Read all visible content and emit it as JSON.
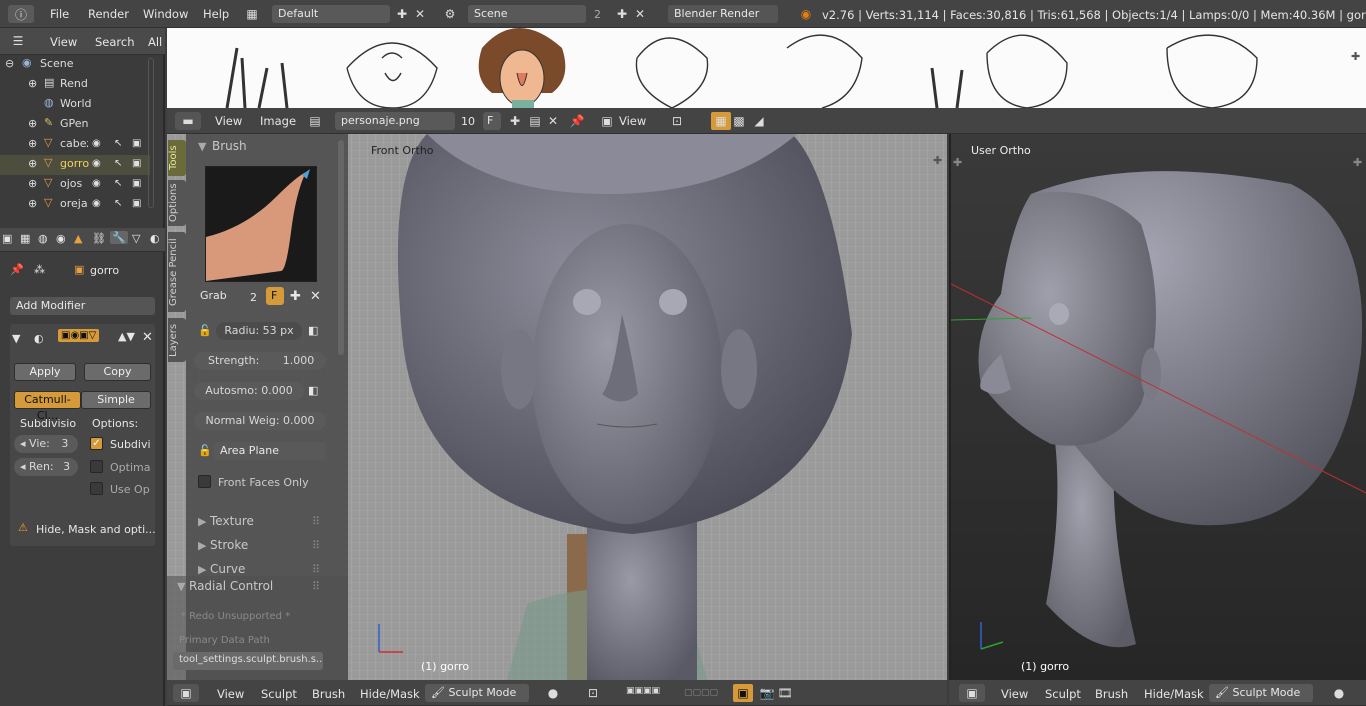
{
  "topbar": {
    "menus": [
      "File",
      "Render",
      "Window",
      "Help"
    ],
    "screen_layout": "Default",
    "scene": "Scene",
    "scene_users": "2",
    "engine": "Blender Render",
    "stats": "v2.76 | Verts:31,114 | Faces:30,816 | Tris:61,568 | Objects:1/4 | Lamps:0/0 | Mem:40.36M | gorro"
  },
  "outliner": {
    "view_label": "View",
    "search_label": "Search",
    "all_label": "All",
    "items": [
      {
        "label": "Scene",
        "icon": "scene-icon"
      },
      {
        "label": "Rend",
        "icon": "render-layers-icon"
      },
      {
        "label": "World",
        "icon": "world-icon"
      },
      {
        "label": "GPen",
        "icon": "grease-pencil-icon"
      },
      {
        "label": "cabeza",
        "icon": "mesh-icon"
      },
      {
        "label": "gorro",
        "icon": "mesh-icon"
      },
      {
        "label": "ojos",
        "icon": "mesh-icon"
      },
      {
        "label": "oreja",
        "icon": "mesh-icon"
      }
    ]
  },
  "properties": {
    "object_name": "gorro",
    "add_modifier": "Add Modifier",
    "apply": "Apply",
    "copy": "Copy",
    "catmull": "Catmull-Cl...",
    "simple": "Simple",
    "subdivisions_label": "Subdivisio",
    "options_label": "Options:",
    "view_field": "Vie:",
    "view_value": "3",
    "render_field": "Ren:",
    "render_value": "3",
    "subdiv_uv": "Subdivi",
    "optimal": "Optima",
    "use_op": "Use Op",
    "warning": "Hide, Mask and opti..."
  },
  "reference": {
    "menus": [
      "View",
      "Image"
    ],
    "image_name": "personaje.png",
    "image_users": "10",
    "fake_user": "F",
    "view_label": "View"
  },
  "tools": {
    "tabs": [
      "Tools",
      "Options",
      "Grease Pencil",
      "Layers"
    ],
    "brush_header": "Brush",
    "brush_name": "Grab",
    "brush_users": "2",
    "brush_fake": "F",
    "radius": "Radiu: 53 px",
    "strength_label": "Strength:",
    "strength_value": "1.000",
    "autosmooth": "Autosmo: 0.000",
    "normal_weight": "Normal Weig: 0.000",
    "plane": "Area Plane",
    "front_faces": "Front Faces Only",
    "sections": [
      "Texture",
      "Stroke",
      "Curve"
    ],
    "radial": "Radial Control",
    "redo": "* Redo Unsupported *",
    "primary": "Primary Data Path",
    "path_value": "tool_settings.sculpt.brush.s..."
  },
  "viewport_left": {
    "label": "Front Ortho",
    "object": "(1) gorro",
    "menus": [
      "View",
      "Sculpt",
      "Brush",
      "Hide/Mask"
    ],
    "mode": "Sculpt Mode"
  },
  "viewport_right": {
    "label": "User Ortho",
    "object": "(1) gorro",
    "menus": [
      "View",
      "Sculpt",
      "Brush",
      "Hide/Mask"
    ],
    "mode": "Sculpt Mode"
  },
  "colors": {
    "accent": "#d59a3a",
    "header": "#4a4a4a",
    "panel": "#3d3d3d"
  }
}
